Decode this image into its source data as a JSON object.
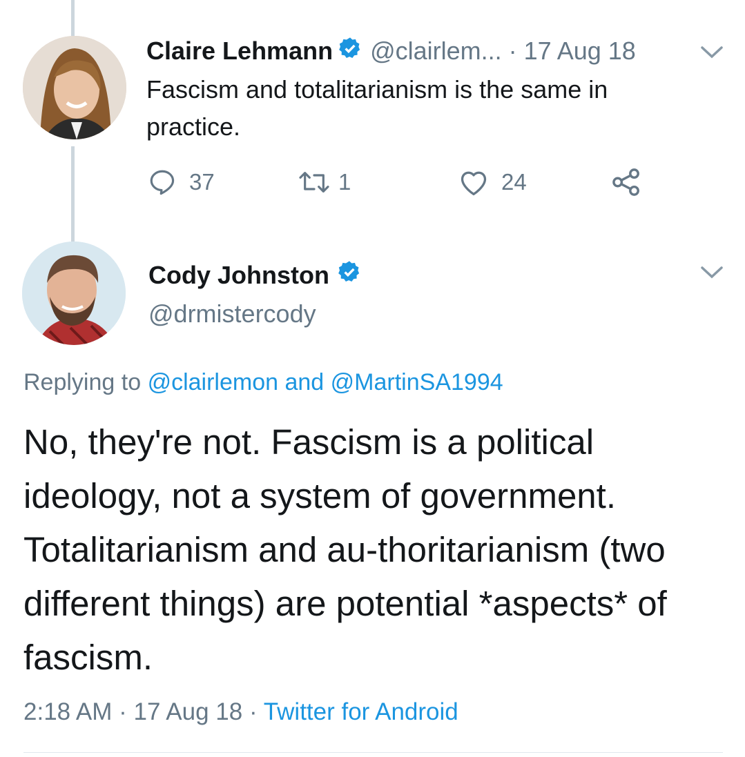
{
  "parent_tweet": {
    "author_name": "Claire Lehmann",
    "handle": "@clairlem...",
    "separator": "·",
    "date": "17 Aug 18",
    "text": "Fascism and totalitarianism is the same in practice.",
    "replies": "37",
    "retweets": "1",
    "likes": "24",
    "avatar_icon": "woman-avatar",
    "verified_icon": "verified-badge-icon"
  },
  "main_tweet": {
    "author_name": "Cody Johnston",
    "handle": "@drmistercody",
    "replying_prefix": "Replying to",
    "reply_to_1": "@clairlemon",
    "reply_and": "and",
    "reply_to_2": "@MartinSA1994",
    "text": "No, they're not. Fascism is a political ideology, not a system of government. Totalitarianism and au-thoritarianism (two different things) are potential *aspects* of fascism.",
    "time": "2:18 AM",
    "dot1": "·",
    "date": "17 Aug 18",
    "dot2": "·",
    "source": "Twitter for Android",
    "avatar_icon": "bearded-man-avatar"
  },
  "colors": {
    "accent": "#1b95e0",
    "text": "#14171a",
    "muted": "#657786",
    "thread_line": "#ccd6dd"
  }
}
